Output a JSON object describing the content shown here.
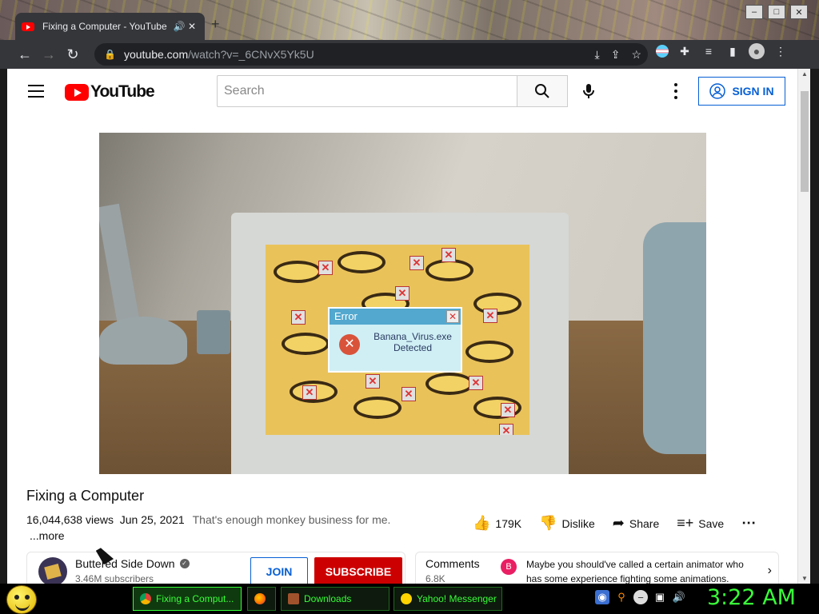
{
  "browser": {
    "tab_title": "Fixing a Computer - YouTube",
    "url_host": "youtube.com",
    "url_path": "/watch?v=_6CNvX5Yk5U"
  },
  "youtube": {
    "logo_text": "YouTube",
    "search_placeholder": "Search",
    "sign_in_label": "SIGN IN"
  },
  "video": {
    "dialog_title": "Error",
    "dialog_message_line1": "Banana_Virus.exe",
    "dialog_message_line2": "Detected",
    "title": "Fixing a Computer",
    "views": "16,044,638 views",
    "date": "Jun 25, 2021",
    "description": "That's enough monkey business for me.",
    "more_label": "...more"
  },
  "actions": {
    "likes": "179K",
    "dislike_label": "Dislike",
    "share_label": "Share",
    "save_label": "Save"
  },
  "channel": {
    "name": "Buttered Side Down",
    "subscribers": "3.46M subscribers",
    "join_label": "JOIN",
    "subscribe_label": "SUBSCRIBE"
  },
  "comments": {
    "header": "Comments",
    "count": "6.8K",
    "avatar_letter": "B",
    "top_comment": "Maybe you should've called a certain animator who has some experience fighting some animations."
  },
  "taskbar": {
    "items": [
      {
        "label": "Fixing a Comput..."
      },
      {
        "label": ""
      },
      {
        "label": "Downloads"
      },
      {
        "label": "Yahoo! Messenger"
      }
    ],
    "clock": "3:22 AM"
  },
  "colors": {
    "yt_red": "#ff0000",
    "subscribe_red": "#cc0000",
    "link_blue": "#065fd4",
    "taskbar_green": "#39ff39"
  }
}
